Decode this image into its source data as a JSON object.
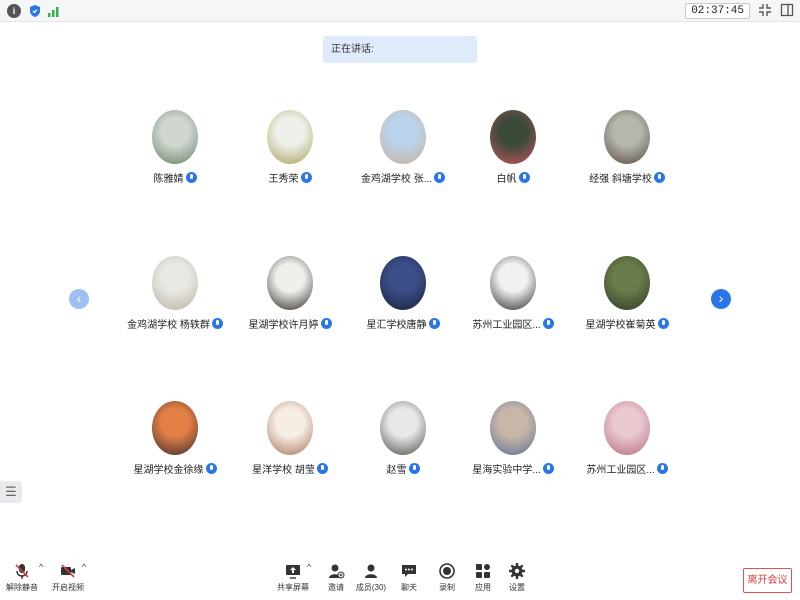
{
  "topbar": {
    "info_icon": "info-icon",
    "clock": "02:37:45"
  },
  "speaking": {
    "label": "正在讲话:"
  },
  "participants": [
    {
      "name": "陈雅婧",
      "avatar": [
        "#cfd7cf",
        "#6a7f66"
      ]
    },
    {
      "name": "王秀荣",
      "avatar": [
        "#eef0ea",
        "#a9a15a"
      ]
    },
    {
      "name": "金鸡湖学校 张...",
      "avatar": [
        "#b9d3ea",
        "#c9b09a"
      ]
    },
    {
      "name": "白帆",
      "avatar": [
        "#3c4a3a",
        "#c1565b"
      ]
    },
    {
      "name": "经强 斜塘学校",
      "avatar": [
        "#b5b7ae",
        "#5a4a3e"
      ]
    },
    {
      "name": "金鸡湖学校 杨轶群",
      "avatar": [
        "#e9e7e1",
        "#b9b2a6"
      ]
    },
    {
      "name": "星湖学校许月婷",
      "avatar": [
        "#f0f0ea",
        "#2f2a26"
      ]
    },
    {
      "name": "星汇学校唐静",
      "avatar": [
        "#3b4e8a",
        "#1b2032"
      ]
    },
    {
      "name": "苏州工业园区...",
      "avatar": [
        "#f1f1f1",
        "#2c2c2c"
      ]
    },
    {
      "name": "星湖学校崔菊英",
      "avatar": [
        "#6b7b4a",
        "#2f3a2a"
      ]
    },
    {
      "name": "星湖学校金徐缘",
      "avatar": [
        "#e28045",
        "#3b2a32"
      ]
    },
    {
      "name": "星洋学校 胡莹",
      "avatar": [
        "#f6eee5",
        "#a8735a"
      ]
    },
    {
      "name": "赵雪",
      "avatar": [
        "#e8e8e6",
        "#4c4f4a"
      ]
    },
    {
      "name": "星海实验中学...",
      "avatar": [
        "#c8b7a8",
        "#5b6f8f"
      ]
    },
    {
      "name": "苏州工业园区...",
      "avatar": [
        "#e9c8cf",
        "#b76a7c"
      ]
    }
  ],
  "nav": {
    "prev": "‹",
    "next": "›"
  },
  "side_toggle": "☰",
  "toolbar": {
    "unmute": "解除静音",
    "start_video": "开启视频",
    "share_screen": "共享屏幕",
    "invite": "邀请",
    "members": "成员(30)",
    "chat": "聊天",
    "record": "录制",
    "apps": "应用",
    "settings": "设置",
    "leave": "离开会议"
  }
}
